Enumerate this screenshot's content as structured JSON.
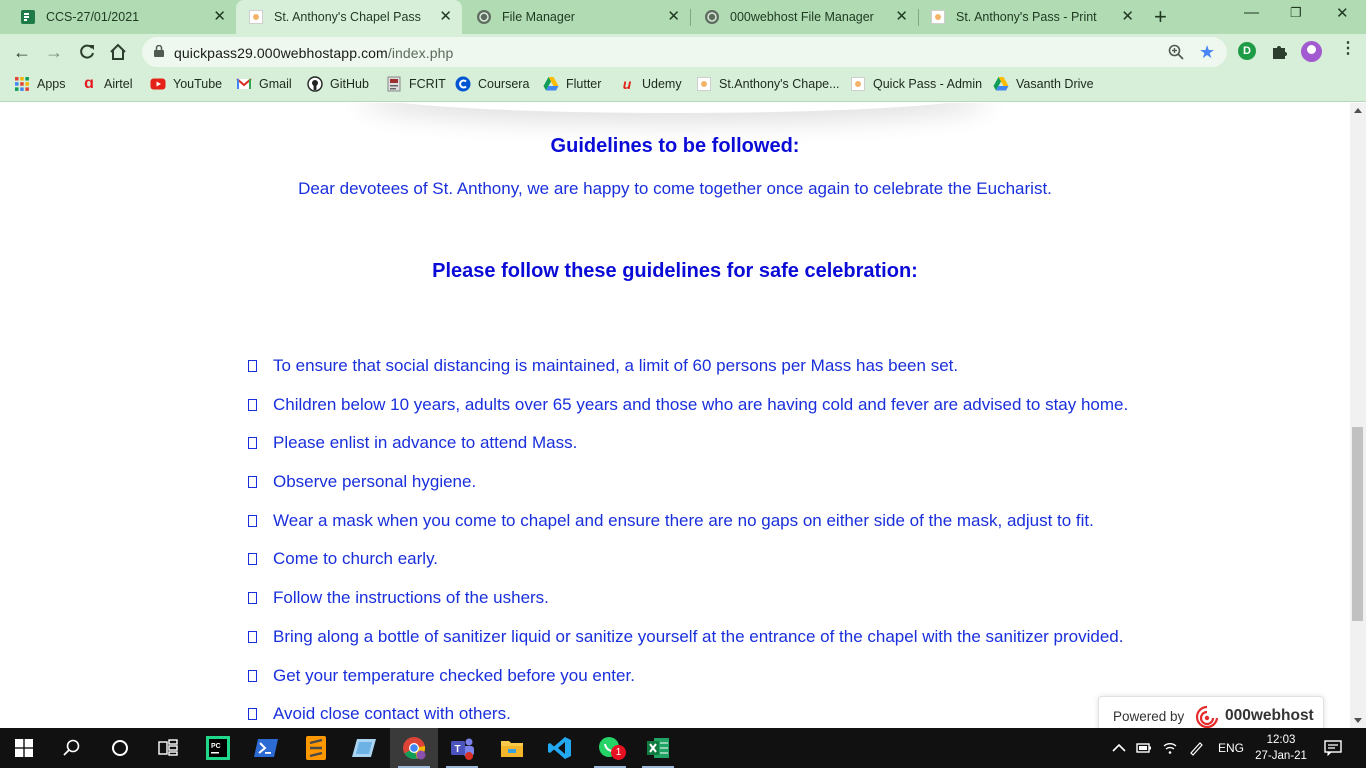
{
  "browser": {
    "tabs": [
      {
        "title": "CCS-27/01/2021",
        "active": false
      },
      {
        "title": "St. Anthony's Chapel Pass",
        "active": true
      },
      {
        "title": "File Manager",
        "active": false
      },
      {
        "title": "000webhost File Manager",
        "active": false
      },
      {
        "title": "St. Anthony's Pass - Print",
        "active": false
      }
    ],
    "url_host": "quickpass29.000webhostapp.com",
    "url_path": "/index.php",
    "profile_initial": "D",
    "bookmarks": [
      {
        "label": "Apps",
        "icon": "apps-grid-icon"
      },
      {
        "label": "Airtel",
        "icon": "airtel-icon"
      },
      {
        "label": "YouTube",
        "icon": "youtube-icon"
      },
      {
        "label": "Gmail",
        "icon": "gmail-icon"
      },
      {
        "label": "GitHub",
        "icon": "github-icon"
      },
      {
        "label": "FCRIT",
        "icon": "fcrit-icon"
      },
      {
        "label": "Coursera",
        "icon": "coursera-icon"
      },
      {
        "label": "Flutter",
        "icon": "google-drive-icon"
      },
      {
        "label": "Udemy",
        "icon": "udemy-icon"
      },
      {
        "label": "St.Anthony's Chape...",
        "icon": "site-icon"
      },
      {
        "label": "Quick Pass - Admin",
        "icon": "site-icon"
      },
      {
        "label": "Vasanth Drive",
        "icon": "google-drive-icon"
      }
    ]
  },
  "page": {
    "guidelines_heading": "Guidelines to be followed:",
    "intro": "Dear devotees of St. Anthony, we are happy to come together once again to celebrate the Eucharist.",
    "safe_heading": "Please follow these guidelines for safe celebration:",
    "guidelines": [
      "To ensure that social distancing is maintained, a limit of 60 persons per Mass has been set.",
      "Children below 10 years, adults over 65 years and those who are having cold and fever are advised to stay home.",
      "Please enlist in advance to attend Mass.",
      "Observe personal hygiene.",
      "Wear a mask when you come to chapel and ensure there are no gaps on either side of the mask, adjust to fit.",
      "Come to church early.",
      "Follow the instructions of the ushers.",
      "Bring along a bottle of sanitizer liquid or sanitize yourself at the entrance of the chapel with the sanitizer provided.",
      "Get your temperature checked before you enter.",
      "Avoid close contact with others."
    ],
    "powered_label": "Powered by",
    "powered_brand": "000webhost"
  },
  "taskbar": {
    "language": "ENG",
    "time": "12:03",
    "date": "27-Jan-21",
    "whatsapp_badge": "1"
  },
  "colors": {
    "heading": "#0b0bd8",
    "text": "#1a2fdc",
    "chrome_frame": "#b0dbb3",
    "chrome_toolbar": "#d7eed8"
  }
}
